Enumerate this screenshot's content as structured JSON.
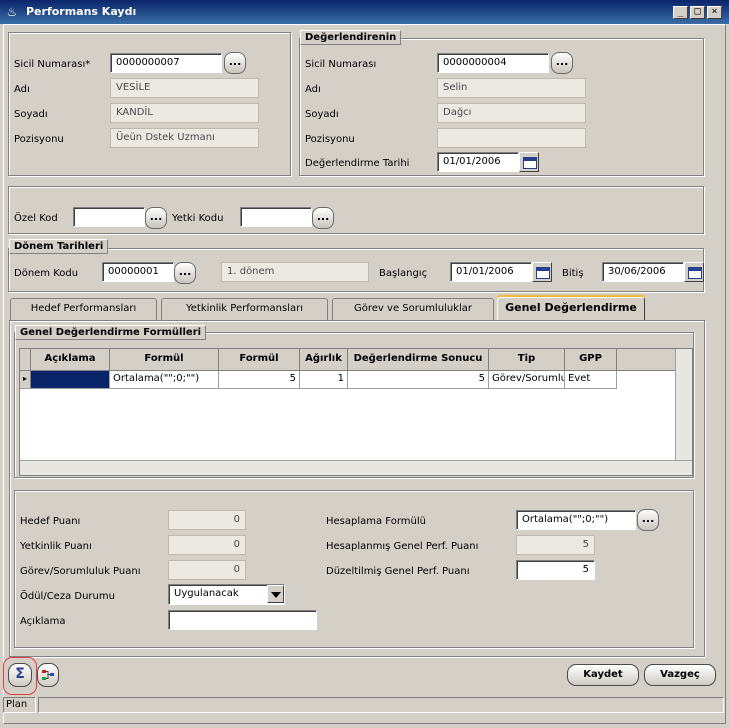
{
  "window": {
    "title": "Performans Kaydı",
    "controls": {
      "minimize": "_",
      "maximize": "□",
      "close": "×"
    }
  },
  "employee": {
    "sicil_label": "Sicil Numarası*",
    "sicil_value": "0000000007",
    "adi_label": "Adı",
    "adi_value": "VESİLE",
    "soyadi_label": "Soyadı",
    "soyadi_value": "KANDİL",
    "pozisyon_label": "Pozisyonu",
    "pozisyon_value": "Üeün Dstek Uzmanı"
  },
  "evaluator": {
    "group_label": "Değerlendirenin",
    "sicil_label": "Sicil Numarası",
    "sicil_value": "0000000004",
    "adi_label": "Adı",
    "adi_value": "Selin",
    "soyadi_label": "Soyadı",
    "soyadi_value": "Dağcı",
    "pozisyon_label": "Pozisyonu",
    "pozisyon_value": "",
    "tarih_label": "Değerlendirme Tarihi",
    "tarih_value": "01/01/2006"
  },
  "codes": {
    "ozel_label": "Özel Kod",
    "ozel_value": "",
    "yetki_label": "Yetki Kodu",
    "yetki_value": ""
  },
  "period": {
    "group_label": "Dönem Tarihleri",
    "kod_label": "Dönem Kodu",
    "kod_value": "00000001",
    "kod_desc": "1. dönem",
    "baslangic_label": "Başlangıç",
    "baslangic_value": "01/01/2006",
    "bitis_label": "Bitiş",
    "bitis_value": "30/06/2006"
  },
  "lookup_glyph": "...",
  "tabs": [
    {
      "label": "Hedef Performansları"
    },
    {
      "label": "Yetkinlik Performansları"
    },
    {
      "label": "Görev ve Sorumluluklar"
    },
    {
      "label": "Genel Değerlendirme"
    }
  ],
  "formulas": {
    "group_label": "Genel Değerlendirme Formülleri",
    "columns": [
      "Açıklama",
      "Formül",
      "Formül Sonucu",
      "Ağırlık",
      "Değerlendirme Sonucu",
      "Tip",
      "GPP"
    ],
    "rows": [
      {
        "aciklama": "",
        "formul": "Ortalama(\"\";0;\"\")",
        "formul_sonucu": "5",
        "agirlik": "1",
        "deger_sonucu": "5",
        "tip": "Görev/Sorumlu",
        "gpp": "Evet"
      }
    ]
  },
  "scores": {
    "hedef_label": "Hedef Puanı",
    "hedef_value": "0",
    "yetkinlik_label": "Yetkinlik Puanı",
    "yetkinlik_value": "0",
    "gorev_label": "Görev/Sorumluluk Puanı",
    "gorev_value": "0",
    "odul_label": "Ödül/Ceza Durumu",
    "odul_value": "Uygulanacak",
    "aciklama_label": "Açıklama",
    "aciklama_value": "",
    "hesaplama_label": "Hesaplama Formülü",
    "hesaplama_value": "Ortalama(\"\";0;\"\")",
    "hesaplanmis_label": "Hesaplanmış Genel Perf. Puanı",
    "hesaplanmis_value": "5",
    "duzeltilmis_label": "Düzeltilmiş Genel Perf. Puanı",
    "duzeltilmis_value": "5"
  },
  "buttons": {
    "sigma": "Σ",
    "kaydet": "Kaydet",
    "vazgec": "Vazgeç"
  },
  "statusbar": {
    "text": "Plan"
  },
  "colors": {
    "title_start": "#0a246a",
    "title_end": "#3a6ea5",
    "selected_cell": "#0a246a",
    "active_tab_accent": "#f0b93a",
    "highlight_ring": "#e04040"
  }
}
